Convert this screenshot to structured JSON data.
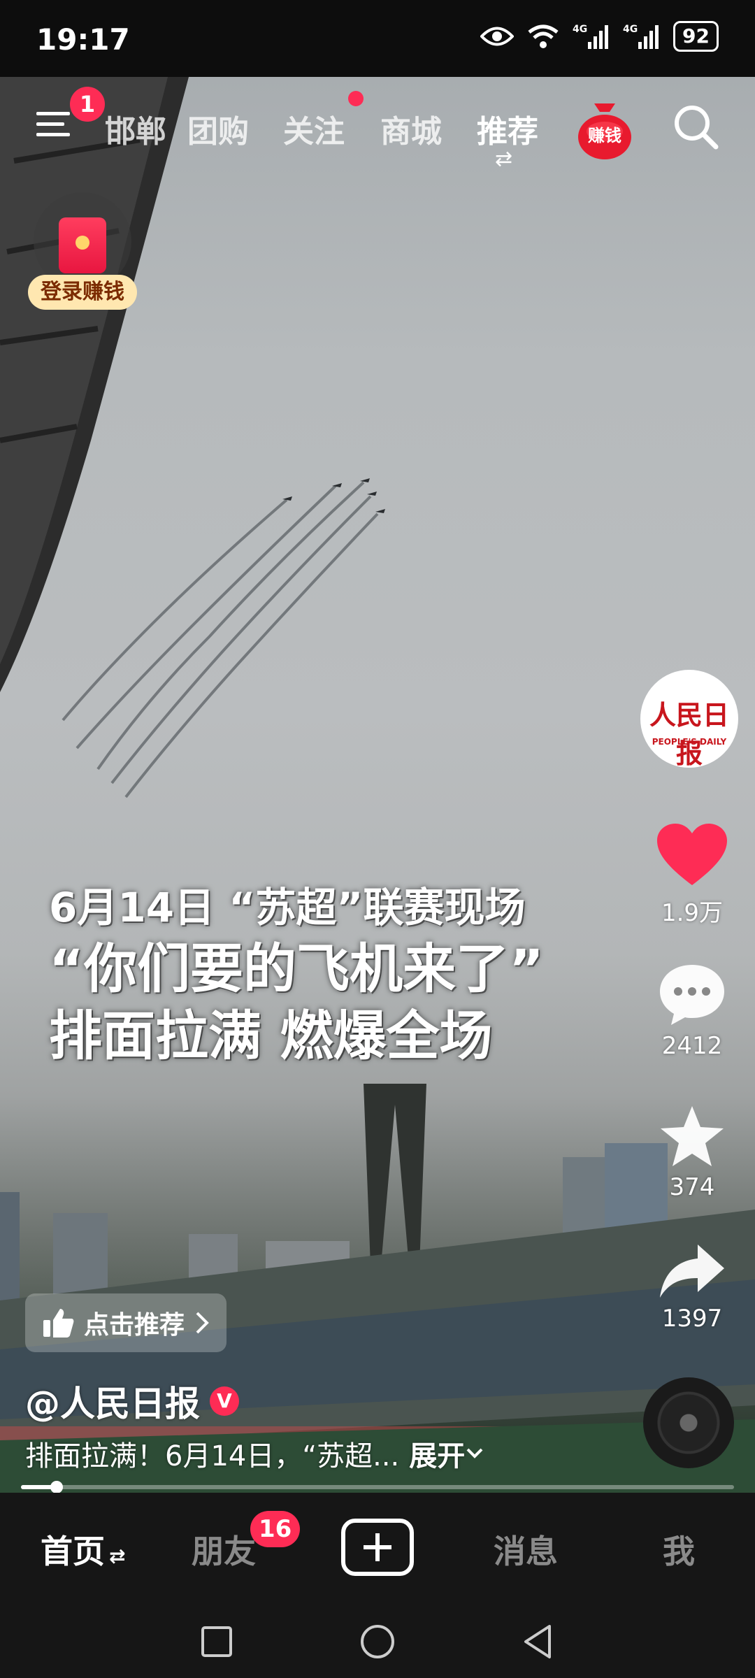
{
  "status_bar": {
    "time": "19:17",
    "battery": "92",
    "network": "4G"
  },
  "top_nav": {
    "menu_badge": "1",
    "tabs": [
      {
        "label": "邯郸",
        "active": false
      },
      {
        "label": "团购",
        "active": false
      },
      {
        "label": "关注",
        "active": false,
        "dot": true
      },
      {
        "label": "商城",
        "active": false
      },
      {
        "label": "推荐",
        "active": true
      }
    ],
    "earn_label": "赚钱"
  },
  "login_earn": {
    "label": "登录赚钱"
  },
  "video": {
    "caption": {
      "line1": "6月14日 “苏超”联赛现场",
      "line2": "“你们要的飞机来了”",
      "line3": "排面拉满 燃爆全场"
    },
    "progress_fraction": 0.05
  },
  "right_rail": {
    "avatar_text": "人民日报",
    "avatar_subtext": "PEOPLE'S DAILY",
    "likes": "1.9万",
    "comments": "2412",
    "favorites": "374",
    "shares": "1397"
  },
  "recommend": {
    "label": "点击推荐"
  },
  "author": {
    "name": "@人民日报",
    "verified": "V"
  },
  "description": {
    "text": "排面拉满！6月14日，“苏超...",
    "expand_label": "展开"
  },
  "bottom_tabs": [
    {
      "label": "首页",
      "active": true
    },
    {
      "label": "朋友",
      "active": false,
      "badge": "16"
    },
    {
      "label": "消息",
      "active": false
    },
    {
      "label": "我",
      "active": false
    }
  ],
  "colors": {
    "accent": "#fe2c55",
    "heart": "#fe2c55",
    "tabbar_bg": "#161616"
  }
}
